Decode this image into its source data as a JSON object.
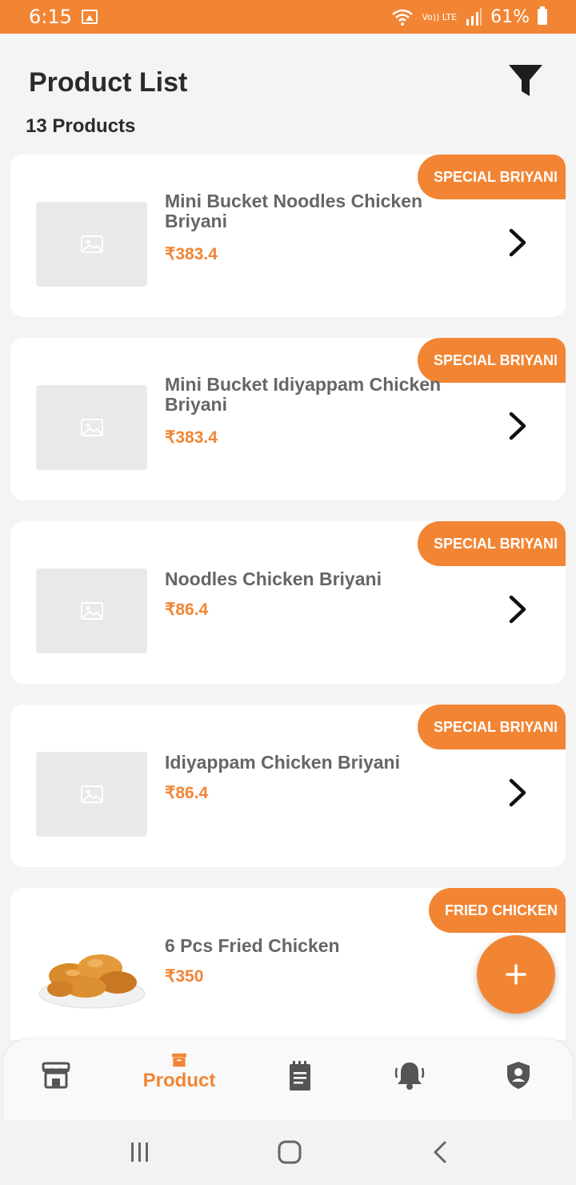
{
  "status_bar": {
    "time": "6:15",
    "network": "Vo)) LTE",
    "battery": "61%"
  },
  "header": {
    "title": "Product List",
    "count_label": "13 Products"
  },
  "products": [
    {
      "name": "Mini Bucket Noodles Chicken Briyani",
      "price": "₹383.4",
      "tag": "SPECIAL BRIYANI",
      "image": "placeholder-image-icon"
    },
    {
      "name": "Mini Bucket Idiyappam Chicken Briyani",
      "price": "₹383.4",
      "tag": "SPECIAL BRIYANI",
      "image": "placeholder-image-icon"
    },
    {
      "name": "Noodles Chicken Briyani",
      "price": "₹86.4",
      "tag": "SPECIAL BRIYANI",
      "image": "placeholder-image-icon"
    },
    {
      "name": "Idiyappam Chicken Briyani",
      "price": "₹86.4",
      "tag": "SPECIAL BRIYANI",
      "image": "placeholder-image-icon"
    },
    {
      "name": "6 Pcs Fried Chicken",
      "price": "₹350",
      "tag": "FRIED CHICKEN",
      "image": "fried-chicken-photo"
    }
  ],
  "bottom_nav": {
    "items": [
      {
        "icon": "store-icon",
        "label": ""
      },
      {
        "icon": "product-box-icon",
        "label": "Product",
        "active": true
      },
      {
        "icon": "orders-notepad-icon",
        "label": ""
      },
      {
        "icon": "notification-bell-icon",
        "label": ""
      },
      {
        "icon": "profile-shield-icon",
        "label": ""
      }
    ]
  },
  "colors": {
    "accent": "#f28534",
    "background": "#f4f4f5",
    "card": "#ffffff",
    "text_dark": "#2b2b2b",
    "text_muted": "#666666"
  }
}
